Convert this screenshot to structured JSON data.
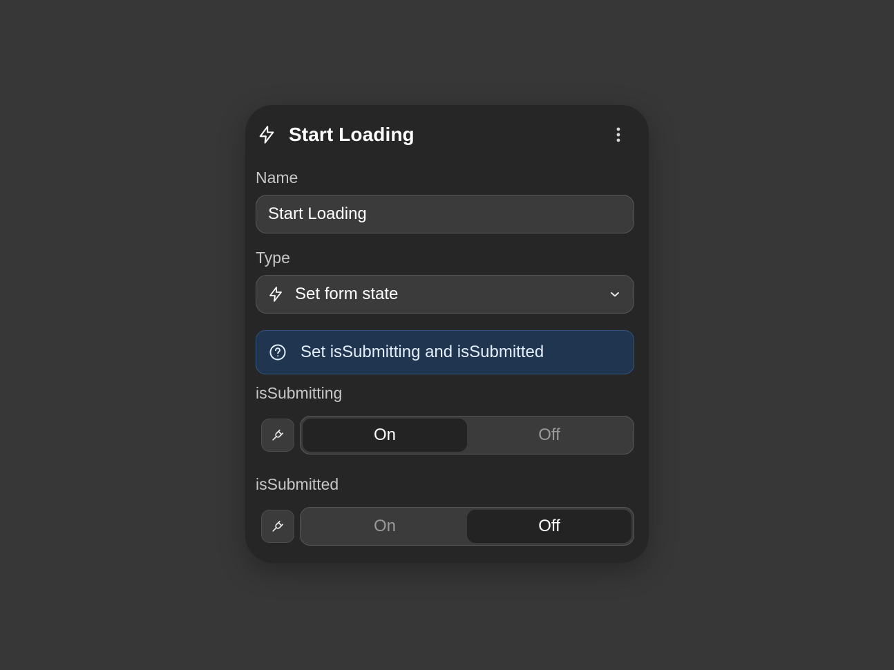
{
  "panel": {
    "title": "Start Loading",
    "header_icon": "bolt-icon",
    "menu_icon": "kebab-menu-icon"
  },
  "name_field": {
    "label": "Name",
    "value": "Start Loading"
  },
  "type_field": {
    "label": "Type",
    "value": "Set form state",
    "icon": "bolt-icon",
    "dropdown_icon": "chevron-down-icon"
  },
  "info_banner": {
    "icon": "help-circle-icon",
    "text": "Set isSubmitting and isSubmitted"
  },
  "toggles": [
    {
      "label": "isSubmitting",
      "bind_icon": "plug-icon",
      "options": [
        "On",
        "Off"
      ],
      "selected": "On"
    },
    {
      "label": "isSubmitted",
      "bind_icon": "plug-icon",
      "options": [
        "On",
        "Off"
      ],
      "selected": "Off"
    }
  ],
  "colors": {
    "background": "#373737",
    "card": "#262626",
    "field": "#3b3b3b",
    "info_bg": "#203550",
    "info_border": "#31557f"
  }
}
